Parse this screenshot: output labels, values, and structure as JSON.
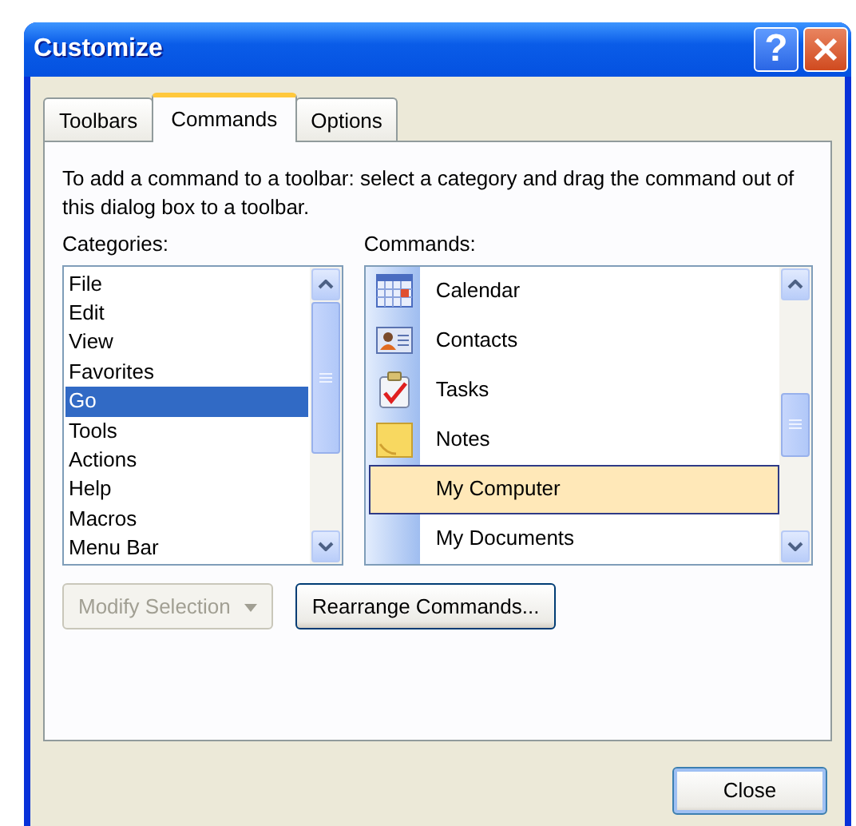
{
  "window": {
    "title": "Customize"
  },
  "title_buttons": [
    {
      "kind": "help",
      "glyph": "?"
    },
    {
      "kind": "close"
    }
  ],
  "tabs": [
    {
      "label": "Toolbars",
      "selected": false
    },
    {
      "label": "Commands",
      "selected": true
    },
    {
      "label": "Options",
      "selected": false
    }
  ],
  "instructions": "To add a command to a toolbar: select a category and drag the command out of this dialog box to a toolbar.",
  "categories": {
    "label": "Categories:",
    "items": [
      {
        "label": "File",
        "selected": false
      },
      {
        "label": "Edit",
        "selected": false
      },
      {
        "label": "View",
        "selected": false
      },
      {
        "label": "Favorites",
        "selected": false
      },
      {
        "label": "Go",
        "selected": true
      },
      {
        "label": "Tools",
        "selected": false
      },
      {
        "label": "Actions",
        "selected": false
      },
      {
        "label": "Help",
        "selected": false
      },
      {
        "label": "Macros",
        "selected": false
      },
      {
        "label": "Menu Bar",
        "selected": false
      }
    ]
  },
  "commands": {
    "label": "Commands:",
    "items": [
      {
        "label": "Calendar",
        "kind": "calendar",
        "selected": false
      },
      {
        "label": "Contacts",
        "kind": "contacts",
        "selected": false
      },
      {
        "label": "Tasks",
        "kind": "tasks",
        "selected": false
      },
      {
        "label": "Notes",
        "kind": "notes",
        "selected": false
      },
      {
        "label": "My Computer",
        "kind": "plain",
        "selected": true
      },
      {
        "label": "My Documents",
        "kind": "plain",
        "selected": false
      }
    ]
  },
  "buttons": [
    {
      "label": "Modify Selection",
      "kind": "dropdown",
      "disabled": true
    },
    {
      "label": "Rearrange Commands...",
      "kind": "plain",
      "disabled": false
    }
  ],
  "footer_buttons": [
    {
      "label": "Close"
    }
  ]
}
